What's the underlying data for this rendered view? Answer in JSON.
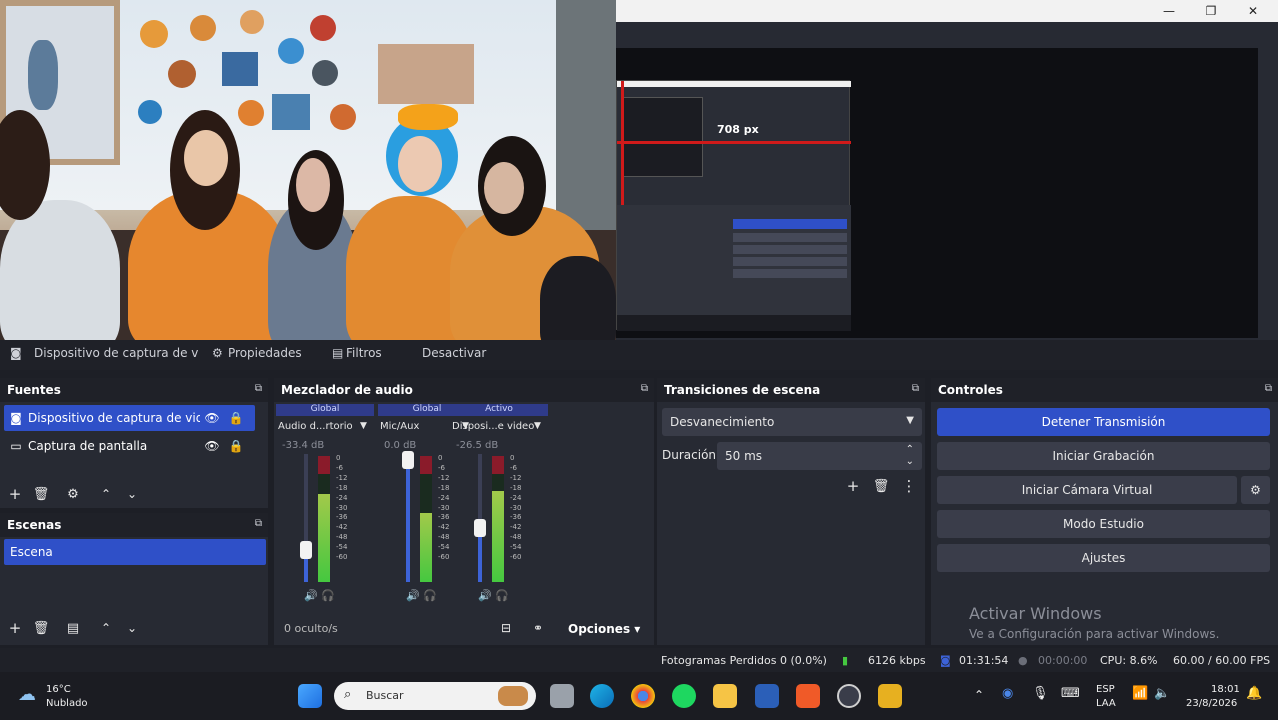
{
  "window": {
    "minimize_glyph": "—",
    "maximize_glyph": "❐",
    "close_glyph": "✕"
  },
  "preview": {
    "nested_label": "708 px"
  },
  "source_toolbar": {
    "source_name": "Dispositivo de captura de v",
    "properties": "Propiedades",
    "filters": "Filtros",
    "deactivate": "Desactivar"
  },
  "sources": {
    "title": "Fuentes",
    "items": [
      {
        "label": "Dispositivo de captura de video",
        "icon": "camera-icon",
        "selected": true
      },
      {
        "label": "Captura de pantalla",
        "icon": "monitor-icon",
        "selected": false
      }
    ]
  },
  "scenes": {
    "title": "Escenas",
    "items": [
      {
        "label": "Escena",
        "selected": true
      }
    ]
  },
  "mixer": {
    "title": "Mezclador de audio",
    "channels": [
      {
        "head": "Global",
        "name": "Audio d...rtorio",
        "db": "-33.4 dB",
        "volume": 0.25,
        "meter": 0.7
      },
      {
        "head": "Global",
        "name": "Mic/Aux",
        "db": "0.0 dB",
        "volume": 0.95,
        "meter": 0.55
      },
      {
        "head": "Activo",
        "name": "Disposi...e video",
        "db": "-26.5 dB",
        "volume": 0.42,
        "meter": 0.72
      }
    ],
    "scale": [
      "0",
      "-6",
      "-12",
      "-18",
      "-24",
      "-30",
      "-36",
      "-42",
      "-48",
      "-54",
      "-60"
    ],
    "hidden": "0 oculto/s",
    "options": "Opciones"
  },
  "transitions": {
    "title": "Transiciones de escena",
    "selected": "Desvanecimiento",
    "duration_label": "Duración",
    "duration_value": "50 ms"
  },
  "controls": {
    "title": "Controles",
    "buttons": [
      "Detener Transmisión",
      "Iniciar Grabación",
      "Iniciar Cámara Virtual",
      "Modo Estudio",
      "Ajustes"
    ]
  },
  "watermark": {
    "line1": "Activar Windows",
    "line2": "Ve a Configuración para activar Windows."
  },
  "status": {
    "dropped": "Fotogramas Perdidos 0 (0.0%)",
    "kbps": "6126 kbps",
    "stream_time": "01:31:54",
    "rec_time": "00:00:00",
    "cpu": "CPU: 8.6%",
    "fps": "60.00 / 60.00 FPS"
  },
  "taskbar": {
    "weather_temp": "16°C",
    "weather_desc": "Nublado",
    "search_placeholder": "Buscar",
    "lang1": "ESP",
    "lang2": "LAA",
    "time": "18:01",
    "date": "23/8/2026"
  },
  "colors": {
    "accent": "#2f50c8",
    "panel": "#272a33",
    "header": "#1f2128"
  }
}
